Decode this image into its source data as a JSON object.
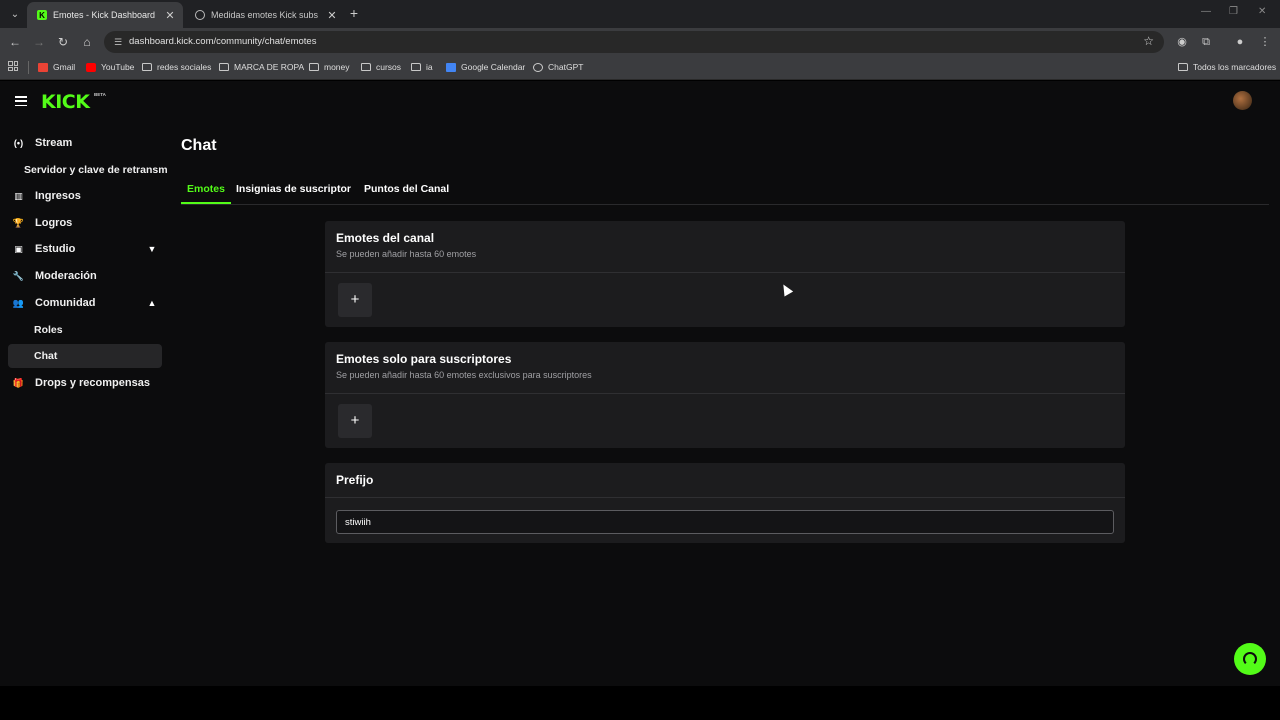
{
  "browser": {
    "tabs": [
      {
        "title": "Emotes - Kick Dashboard",
        "active": true
      },
      {
        "title": "Medidas emotes Kick subs",
        "active": false
      }
    ],
    "url": "dashboard.kick.com/community/chat/emotes",
    "bookmarks": [
      "Gmail",
      "YouTube",
      "redes sociales",
      "MARCA DE ROPA",
      "money",
      "cursos",
      "ia",
      "Google Calendar",
      "ChatGPT"
    ],
    "all_bookmarks": "Todos los marcadores"
  },
  "brand": {
    "logo": "KICK",
    "badge": "BETA",
    "accent": "#53fc18"
  },
  "sidebar": {
    "items": [
      {
        "label": "Stream",
        "icon": "broadcast-icon"
      },
      {
        "label": "Servidor y clave de retransm"
      },
      {
        "label": "Ingresos",
        "icon": "chart-icon"
      },
      {
        "label": "Logros",
        "icon": "trophy-icon"
      },
      {
        "label": "Estudio",
        "icon": "studio-icon"
      },
      {
        "label": "Moderación",
        "icon": "wrench-icon"
      },
      {
        "label": "Comunidad",
        "icon": "users-icon"
      },
      {
        "label": "Roles"
      },
      {
        "label": "Chat"
      },
      {
        "label": "Drops y recompensas",
        "icon": "gift-icon"
      }
    ]
  },
  "main": {
    "title": "Chat",
    "tabs": [
      {
        "label": "Emotes"
      },
      {
        "label": "Insignias de suscriptor"
      },
      {
        "label": "Puntos del Canal"
      }
    ],
    "channel_emotes": {
      "title": "Emotes del canal",
      "subtitle": "Se pueden añadir hasta 60 emotes",
      "add_label": "+"
    },
    "sub_emotes": {
      "title": "Emotes solo para suscriptores",
      "subtitle": "Se pueden añadir hasta 60 emotes exclusivos para suscriptores",
      "add_label": "+"
    },
    "prefix": {
      "title": "Prefijo",
      "value": "stiwiih"
    }
  }
}
